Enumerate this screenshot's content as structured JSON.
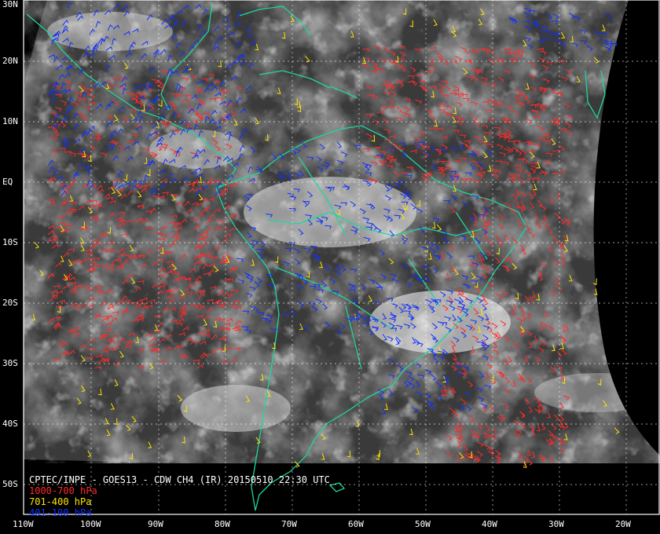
{
  "map": {
    "title": "CPTEC/INPE - GOES13 - CDW CH4 (IR) 20150510 22:30 UTC",
    "legend": [
      {
        "label": "1000-700 hPa",
        "color": "#ff2a2a"
      },
      {
        "label": "701-400 hPa",
        "color": "#ffe600"
      },
      {
        "label": "401-100 hPa",
        "color": "#1030ff"
      }
    ],
    "lat_labels": [
      "30N",
      "20N",
      "10N",
      "EQ",
      "10S",
      "20S",
      "30S",
      "40S",
      "50S"
    ],
    "lon_labels": [
      "110W",
      "100W",
      "90W",
      "80W",
      "70W",
      "60W",
      "50W",
      "40W",
      "30W",
      "20W"
    ],
    "extent": {
      "lon": [
        -110,
        -16
      ],
      "lat": [
        -56,
        30
      ]
    },
    "colors": {
      "coastline": "#1fd6a0",
      "grid": "#ffffff",
      "frame": "#ffffff",
      "space": "#000000"
    }
  }
}
